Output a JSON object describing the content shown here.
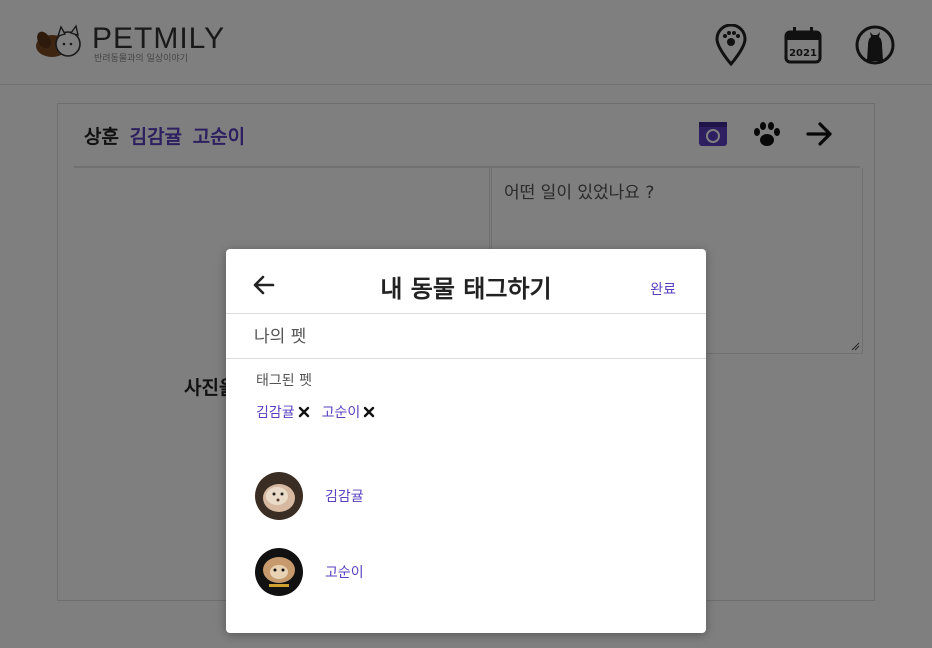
{
  "header": {
    "logo_title": "PETMILY",
    "logo_subtitle": "반려동물과의 일상이야기",
    "icons": [
      "map-pin-paw-icon",
      "calendar-icon",
      "profile-icon"
    ],
    "calendar_year": "2021"
  },
  "post": {
    "author": "상훈",
    "tagged_names": [
      "김감귤",
      "고순이"
    ],
    "photo_placeholder": "사진을",
    "text_placeholder": "어떤 일이 있었나요 ?",
    "accent": "#5a3fc0"
  },
  "modal": {
    "title": "내 동물 태그하기",
    "done_label": "완료",
    "search_placeholder": "나의 펫",
    "tagged_label": "태그된 펫",
    "tagged": [
      {
        "name": "김감귤"
      },
      {
        "name": "고순이"
      }
    ],
    "pets": [
      {
        "name": "김감귤"
      },
      {
        "name": "고순이"
      }
    ]
  }
}
